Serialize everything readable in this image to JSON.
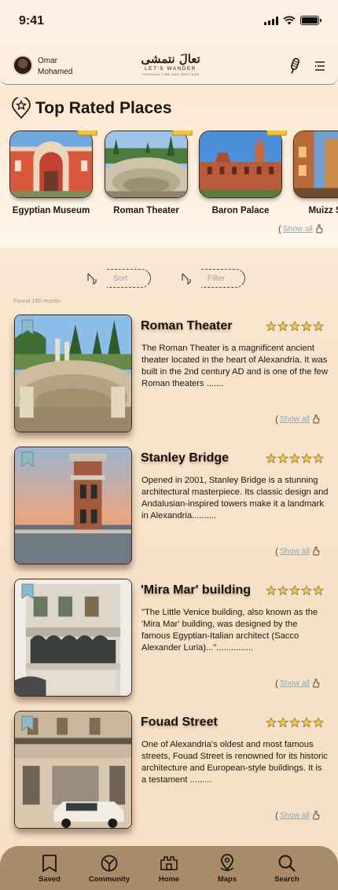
{
  "status_bar": {
    "time": "9:41"
  },
  "header": {
    "user_first_name": "Omar",
    "user_last_name": "Mohamed",
    "logo_arabic": "تعالَ نتمشى",
    "logo_english": "LET'S WANDER",
    "logo_tagline": "THROUGH TIME AND HERITAGE"
  },
  "top_rated": {
    "title": "Top Rated Places",
    "places": [
      {
        "name": "Egyptian Museum"
      },
      {
        "name": "Roman Theater"
      },
      {
        "name": "Baron Palace"
      },
      {
        "name": "Muizz Street"
      }
    ],
    "show_all": "Show all"
  },
  "filters": {
    "sort_label": "Sort",
    "filter_label": "Filter",
    "found_text": "Found 180 results"
  },
  "results": [
    {
      "title": "Roman Theater",
      "rating": 5,
      "description": "The Roman Theater is a magnificent ancient theater located in the heart of Alexandria. It was built in the 2nd century AD and is one of the few Roman theaters .......",
      "show_all": "Show all"
    },
    {
      "title": "Stanley Bridge",
      "rating": 5,
      "description": "Opened in 2001, Stanley Bridge is a stunning architectural masterpiece. Its classic design and Andalusian-inspired towers make it a landmark in Alexandria..........",
      "show_all": "Show all"
    },
    {
      "title": "'Mira Mar' building",
      "rating": 5,
      "description": "\"The Little Venice building, also known as the 'Mira Mar' building, was designed by the famous Egyptian-Italian architect (Sacco Alexander Luria)...\"...............",
      "show_all": "Show all"
    },
    {
      "title": "Fouad Street",
      "rating": 5,
      "description": "One of Alexandria's oldest and most famous streets, Fouad Street is renowned for its historic architecture and European-style buildings. It is a testament .........",
      "show_all": "Show all"
    }
  ],
  "bottom_nav": [
    {
      "label": "Saved",
      "icon": "bookmark-icon"
    },
    {
      "label": "Community",
      "icon": "community-icon"
    },
    {
      "label": "Home",
      "icon": "home-icon"
    },
    {
      "label": "Maps",
      "icon": "map-icon"
    },
    {
      "label": "Search",
      "icon": "search-icon"
    }
  ],
  "colors": {
    "accent_link": "#8ba9b6",
    "nav_background": "#a88b6a",
    "star": "#f2c94c",
    "bookmark": "#8fb9c4"
  }
}
